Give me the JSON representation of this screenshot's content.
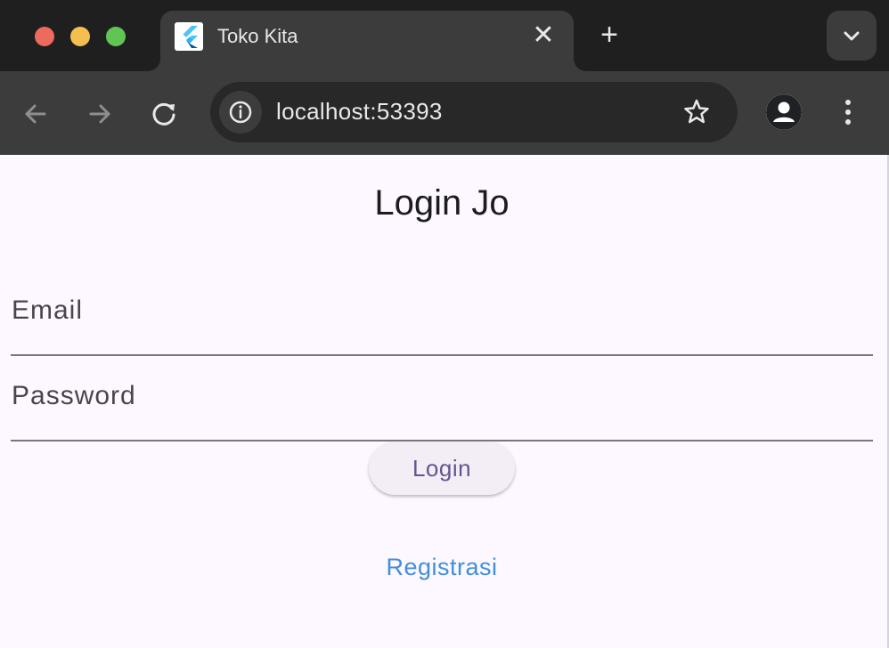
{
  "browser": {
    "tab_title": "Toko Kita",
    "tab_close_glyph": "✕",
    "new_tab_glyph": "+",
    "url": "localhost:53393",
    "icons": [
      "flutter-logo-icon",
      "close-icon",
      "plus-icon",
      "chevron-down-icon",
      "back-arrow-icon",
      "forward-arrow-icon",
      "reload-icon",
      "info-icon",
      "star-icon",
      "profile-icon",
      "more-vert-icon"
    ]
  },
  "page": {
    "title": "Login Jo",
    "email_label": "Email",
    "password_label": "Password",
    "login_button": "Login",
    "register_link": "Registrasi"
  },
  "colors": {
    "chrome_dark": "#1f1f1f",
    "toolbar": "#3c3c3c",
    "page_background": "#fdf7ff",
    "button_text": "#65558f",
    "link": "#3f8fdc"
  }
}
